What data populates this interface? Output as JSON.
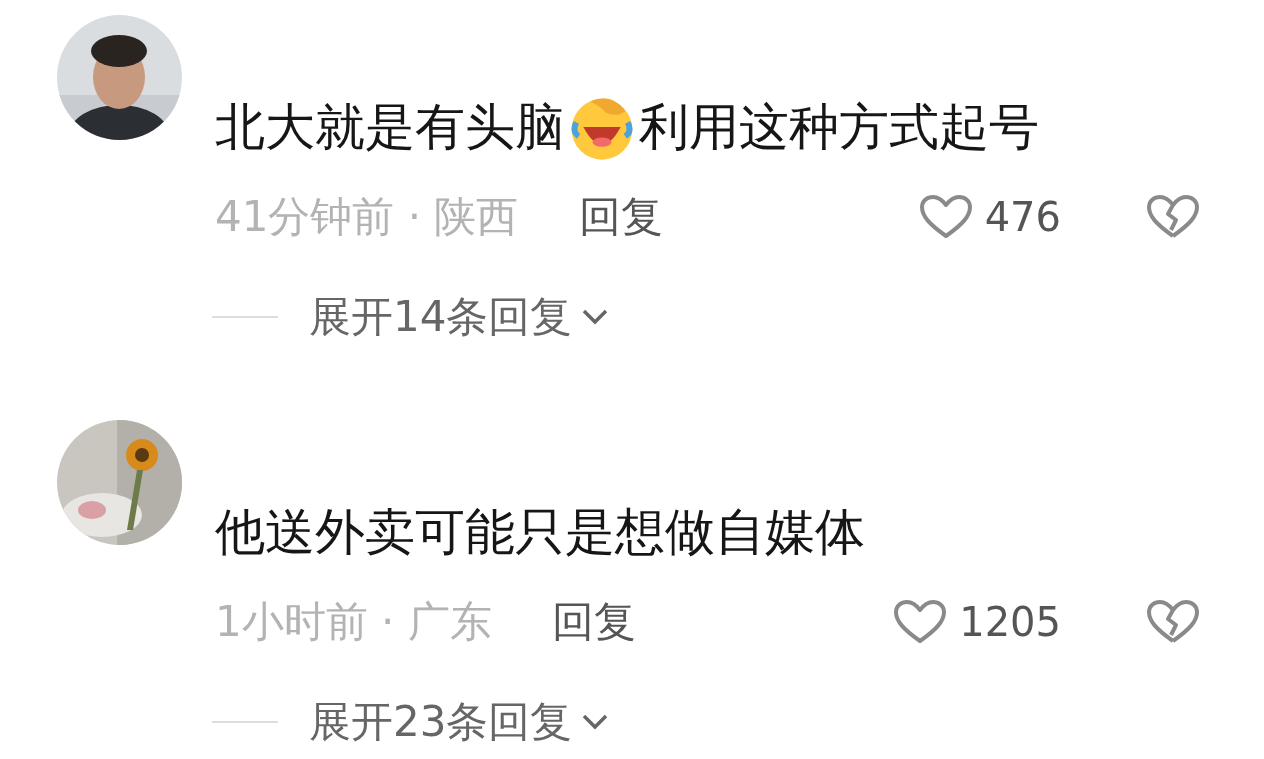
{
  "comments": [
    {
      "avatar": {
        "kind": "picture"
      },
      "segments": [
        {
          "kind": "text",
          "text": "北大就是有头脑"
        },
        {
          "kind": "emoji"
        },
        {
          "kind": "text",
          "text": "利用这种方式起号"
        }
      ],
      "time_location": "41分钟前 · 陕西",
      "reply": "回复",
      "likes": "476",
      "expand": "展开14条回复"
    },
    {
      "avatar": {
        "kind": "picture"
      },
      "segments": [
        {
          "kind": "text",
          "text": "他送外卖可能只是想做自媒体"
        }
      ],
      "time_location": "1小时前 · 广东",
      "reply": "回复",
      "likes": "1205",
      "expand": "展开23条回复"
    }
  ]
}
